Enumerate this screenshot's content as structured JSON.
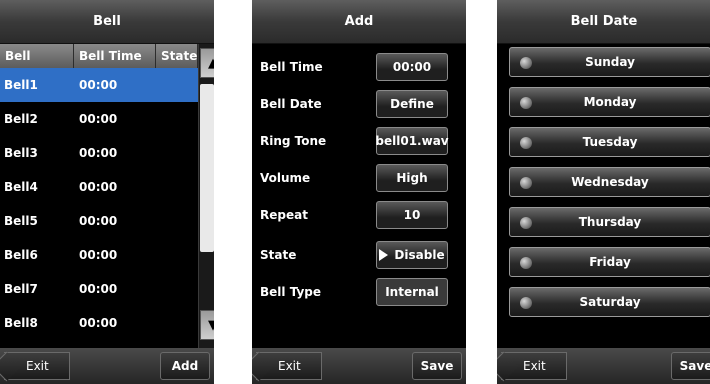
{
  "screen_bell": {
    "title": "Bell",
    "columns": [
      "Bell",
      "Bell Time",
      "State"
    ],
    "rows": [
      {
        "bell": "Bell1",
        "time": "00:00"
      },
      {
        "bell": "Bell2",
        "time": "00:00"
      },
      {
        "bell": "Bell3",
        "time": "00:00"
      },
      {
        "bell": "Bell4",
        "time": "00:00"
      },
      {
        "bell": "Bell5",
        "time": "00:00"
      },
      {
        "bell": "Bell6",
        "time": "00:00"
      },
      {
        "bell": "Bell7",
        "time": "00:00"
      },
      {
        "bell": "Bell8",
        "time": "00:00"
      }
    ],
    "selected_index": 0,
    "exit_label": "Exit",
    "add_label": "Add",
    "scroll_up_icon": "up-arrow-icon",
    "scroll_down_icon": "down-arrow-icon"
  },
  "screen_add": {
    "title": "Add",
    "fields": [
      {
        "label": "Bell Time",
        "value": "00:00"
      },
      {
        "label": "Bell Date",
        "value": "Define"
      },
      {
        "label": "Ring Tone",
        "value": "bell01.wav"
      },
      {
        "label": "Volume",
        "value": "High"
      },
      {
        "label": "Repeat",
        "value": "10"
      },
      {
        "label": "State",
        "value": "Disable"
      },
      {
        "label": "Bell Type",
        "value": "Internal"
      }
    ],
    "exit_label": "Exit",
    "save_label": "Save"
  },
  "screen_date": {
    "title": "Bell Date",
    "days": [
      "Sunday",
      "Monday",
      "Tuesday",
      "Wednesday",
      "Thursday",
      "Friday",
      "Saturday"
    ],
    "exit_label": "Exit",
    "save_label": "Save"
  },
  "colors": {
    "selection": "#2f6fc6",
    "background": "#000000"
  }
}
